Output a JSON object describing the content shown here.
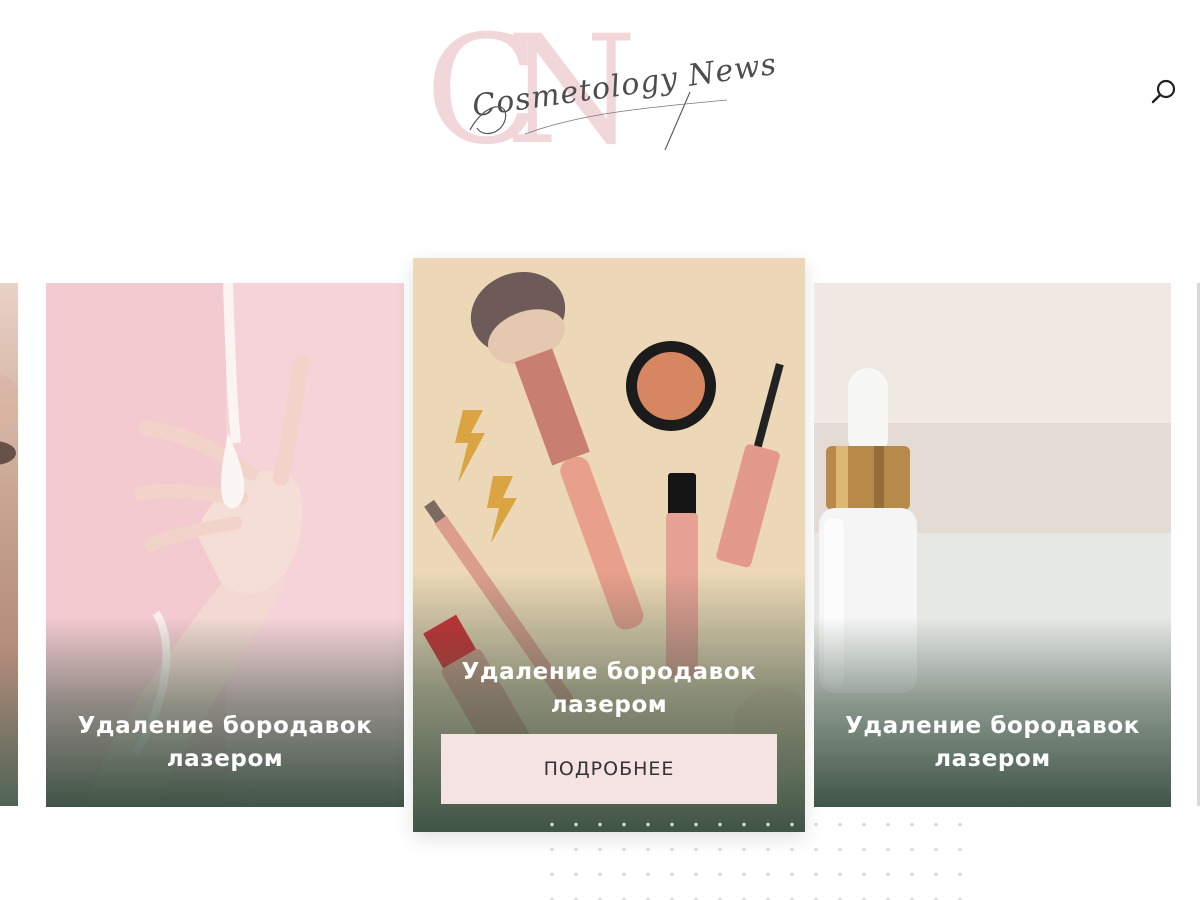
{
  "header": {
    "logo": {
      "monogram": "CN",
      "script_text": "Cosmetology News"
    },
    "search_icon": "search-icon"
  },
  "carousel": {
    "cards": [
      {
        "title": "",
        "image": "face-closeup-photo"
      },
      {
        "title": "Удаление бородавок лазером",
        "image": "hand-with-cream-photo"
      },
      {
        "title": "Удаление бородавок лазером",
        "image": "makeup-brushes-photo",
        "button_label": "ПОДРОБНЕЕ",
        "active": true
      },
      {
        "title": "Удаление бородавок лазером",
        "image": "serum-bottle-photo"
      }
    ]
  },
  "colors": {
    "logo_pink": "#f1d6da",
    "button_bg": "#f5e3e3",
    "overlay_green": "#374e3f",
    "center_bg": "#ecd7b4"
  }
}
